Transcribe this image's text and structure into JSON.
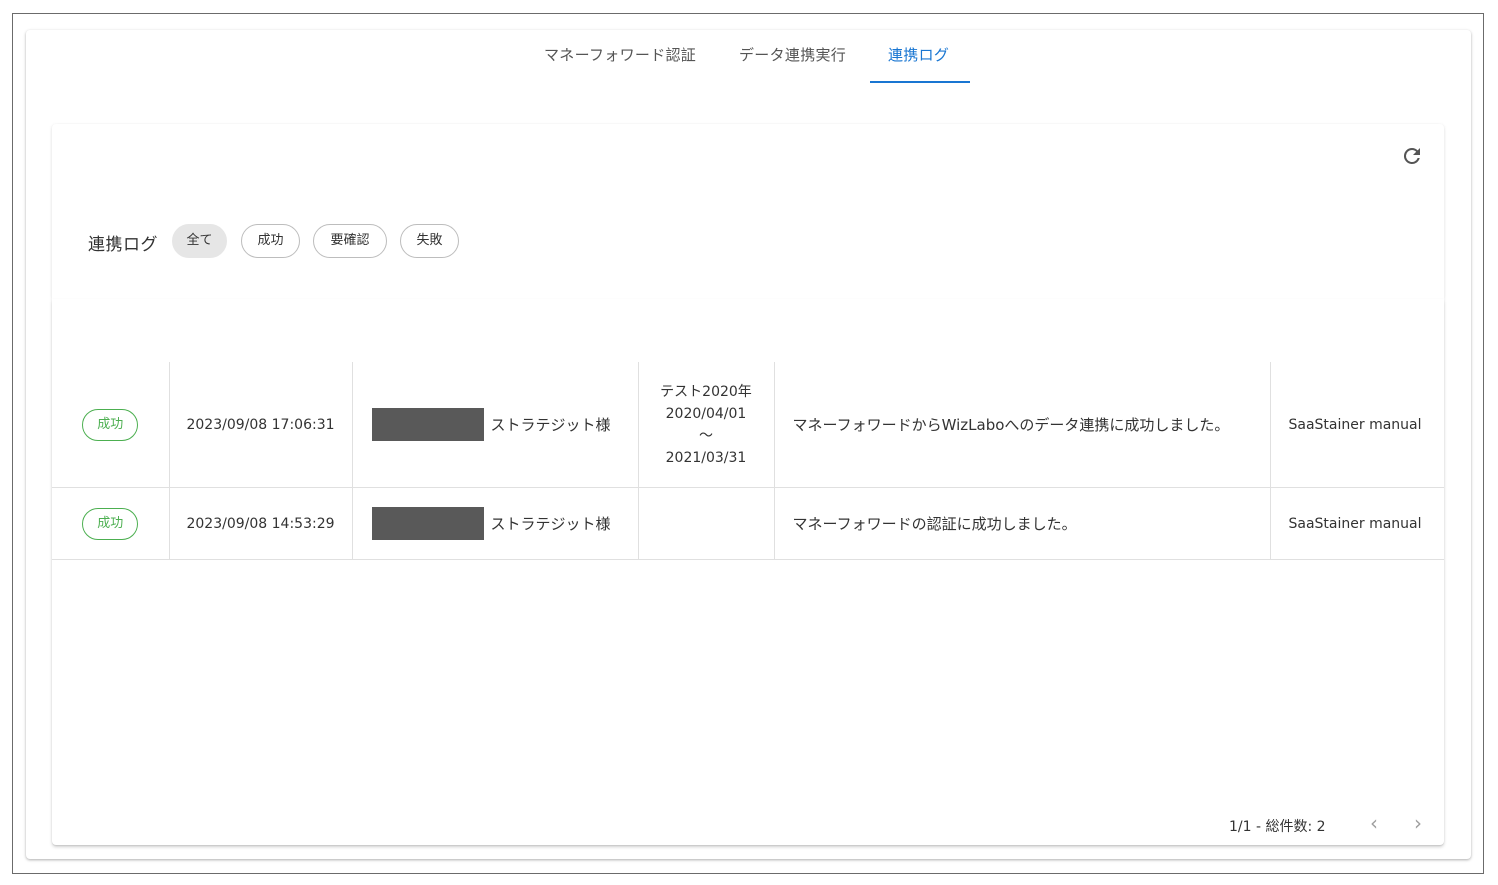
{
  "tabs": [
    {
      "label": "マネーフォワード認証",
      "active": false
    },
    {
      "label": "データ連携実行",
      "active": false
    },
    {
      "label": "連携ログ",
      "active": true
    }
  ],
  "refresh_icon": "refresh-icon",
  "filter": {
    "label": "連携ログ",
    "chips": [
      {
        "label": "全て",
        "selected": true
      },
      {
        "label": "成功",
        "selected": false
      },
      {
        "label": "要確認",
        "selected": false
      },
      {
        "label": "失敗",
        "selected": false
      }
    ]
  },
  "logs": [
    {
      "status": "成功",
      "datetime": "2023/09/08 17:06:31",
      "company": "ストラテジット様",
      "period_name": "テスト2020年",
      "period_start": "2020/04/01",
      "period_sep": "～",
      "period_end": "2021/03/31",
      "message": "マネーフォワードからWizLaboへのデータ連携に成功しました。",
      "user": "SaaStainer manual"
    },
    {
      "status": "成功",
      "datetime": "2023/09/08 14:53:29",
      "company": "ストラテジット様",
      "period_name": "",
      "period_start": "",
      "period_sep": "",
      "period_end": "",
      "message": "マネーフォワードの認証に成功しました。",
      "user": "SaaStainer manual"
    }
  ],
  "pagination": {
    "text": "1/1 - 総件数: 2",
    "prev_icon": "chevron-left-icon",
    "next_icon": "chevron-right-icon",
    "prev": "‹",
    "next": "›"
  },
  "colors": {
    "accent": "#1976d2",
    "success": "#4caf50",
    "redaction": "#595959"
  }
}
